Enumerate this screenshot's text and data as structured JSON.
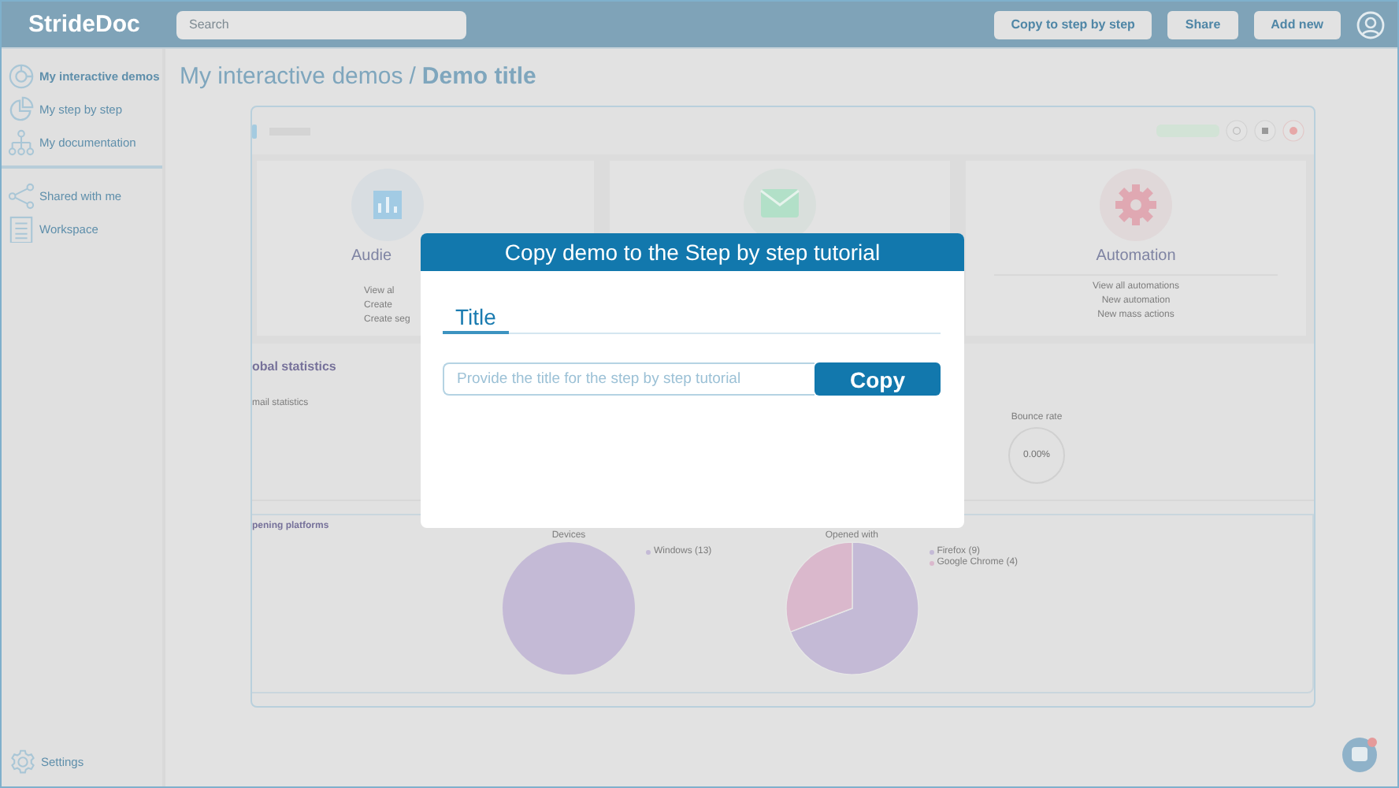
{
  "header": {
    "logo": "StrideDoc",
    "search": {
      "placeholder": "Search"
    },
    "buttons": [
      "Copy to step by step",
      "Share",
      "Add new"
    ]
  },
  "sidebar": {
    "groups": [
      {
        "items": [
          {
            "label": "My interactive demos",
            "selected": true
          },
          {
            "label": "My step by step",
            "selected": false
          },
          {
            "label": "My documentation",
            "selected": false
          }
        ]
      },
      {
        "items": [
          {
            "label": "Shared with me",
            "selected": false
          },
          {
            "label": "Workspace",
            "selected": false
          }
        ]
      }
    ],
    "footer": "Settings"
  },
  "breadcrumb": {
    "path": "My interactive demos",
    "separator": "/",
    "current": "Demo title"
  },
  "frame": {
    "cards": [
      {
        "kind": "audience",
        "title": "Audie",
        "links": [
          "View al",
          "Create",
          "Create seg"
        ]
      },
      {
        "kind": "campaigns"
      },
      {
        "kind": "automation",
        "title": "Automation",
        "links": [
          "View all automations",
          "New automation",
          "New mass actions"
        ]
      }
    ],
    "statistics": {
      "heading": "obal statistics",
      "subheading": "mail statistics",
      "metric_label": "Bounce rate",
      "metric_value": "0.00%"
    },
    "platforms": {
      "heading": "pening platforms",
      "charts": [
        {
          "chart_data": {
            "type": "pie",
            "title": "Devices",
            "categories": [
              "Windows (13)"
            ],
            "values": [
              13
            ],
            "legend": "right"
          }
        },
        {
          "chart_data": {
            "type": "pie",
            "title": "Opened with",
            "categories": [
              "Firefox (9)",
              "Google Chrome (4)"
            ],
            "values": [
              9,
              4
            ],
            "legend": "right"
          }
        }
      ]
    }
  },
  "modal": {
    "title": "Copy demo to the Step by step tutorial",
    "tabs": [
      {
        "label": "Title",
        "selected": true
      }
    ],
    "field": {
      "placeholder": "Provide the title for the step by step tutorial"
    },
    "button": "Copy"
  }
}
